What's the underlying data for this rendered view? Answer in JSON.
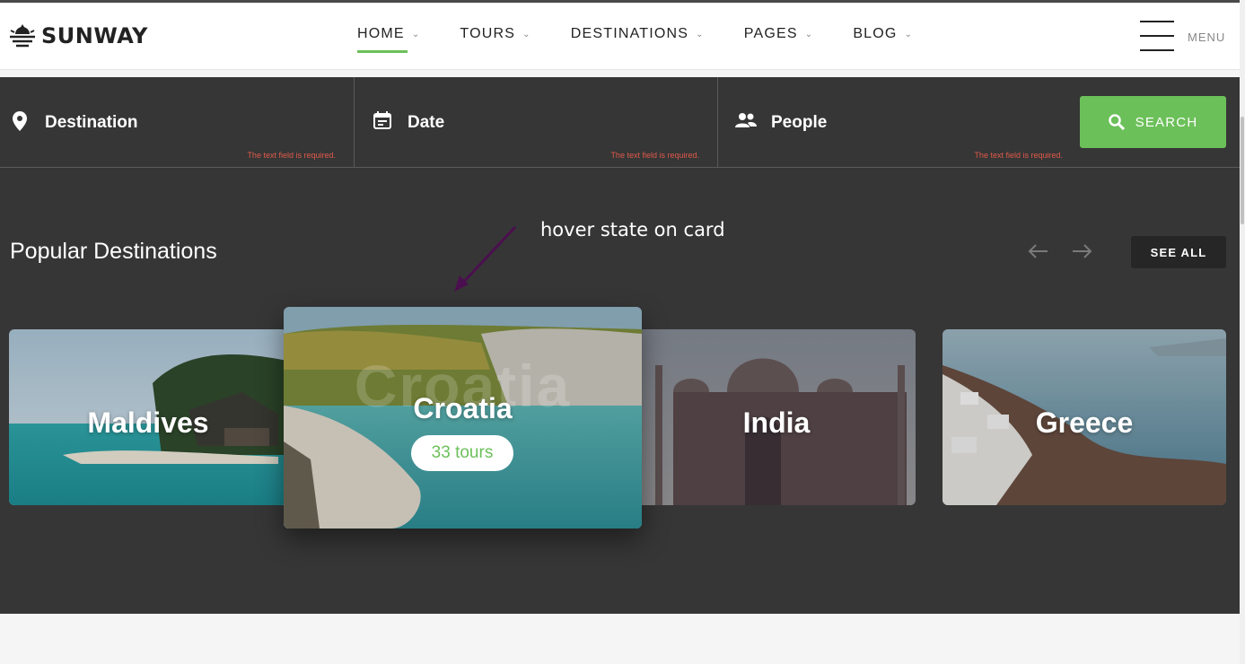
{
  "brand": {
    "name": "SUNWAY"
  },
  "nav": {
    "items": [
      {
        "label": "HOME",
        "active": true
      },
      {
        "label": "TOURS"
      },
      {
        "label": "DESTINATIONS"
      },
      {
        "label": "PAGES"
      },
      {
        "label": "BLOG"
      }
    ],
    "menu_label": "MENU"
  },
  "search": {
    "destination": {
      "label": "Destination",
      "error": "The text field is required."
    },
    "date": {
      "label": "Date",
      "error": "The text field is required."
    },
    "people": {
      "label": "People",
      "error": "The text field is required."
    },
    "button_label": "SEARCH"
  },
  "annotation": "hover state on card",
  "popular": {
    "title": "Popular Destinations",
    "see_all": "SEE ALL",
    "cards": [
      {
        "name": "Maldives"
      },
      {
        "name": "Croatia",
        "tours": "33 tours",
        "hovered": true
      },
      {
        "name": "India"
      },
      {
        "name": "Greece"
      }
    ]
  },
  "colors": {
    "accent": "#6cc05a",
    "dark_bg": "#363636",
    "error": "#e05a4a",
    "arrow": "#4b0f4f"
  }
}
